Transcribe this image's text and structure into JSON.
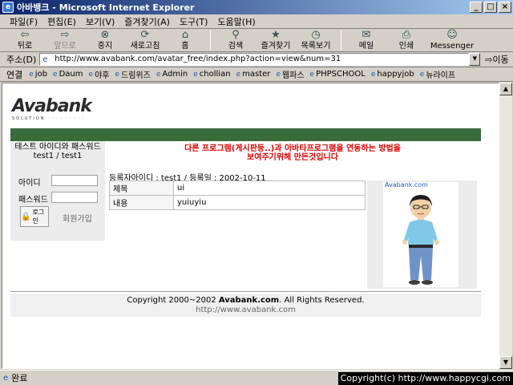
{
  "window": {
    "title": "아바뱅크 - Microsoft Internet Explorer"
  },
  "menu": [
    "파일(F)",
    "편집(E)",
    "보기(V)",
    "즐겨찾기(A)",
    "도구(T)",
    "도움말(H)"
  ],
  "toolbar": {
    "back": "뒤로",
    "forward": "앞으로",
    "stop": "중지",
    "refresh": "새로고침",
    "home": "홈",
    "search": "검색",
    "favorites": "즐겨찾기",
    "history": "목록보기",
    "mail": "메일",
    "print": "인쇄",
    "messenger": "Messenger"
  },
  "address": {
    "label": "주소(D)",
    "url": "http://www.avabank.com/avatar_free/index.php?action=view&num=31",
    "go": "이동"
  },
  "links": {
    "label": "연결",
    "items": [
      "job",
      "Daum",
      "야후",
      "드림위즈",
      "Admin",
      "chollian",
      "master",
      "웹파스",
      "PHPSCHOOL",
      "happyjob",
      "뉴라이프"
    ]
  },
  "page": {
    "logo_main": "Avabank",
    "logo_sub": "SOLUTION",
    "login": {
      "title_line1": "테스트 아이디와 패스워드",
      "title_line2": "test1 / test1",
      "id_label": "아이디",
      "pw_label": "패스워드",
      "login_button": "로그인",
      "signup": "회원가입"
    },
    "notice_line1": "다른 프로그램(게시판등..)과 아바타프로그램을 연동하는 방법을",
    "notice_line2": "보여주기위해 만든것입니다",
    "reg_info": "등록자아이디 : test1 / 등록일 : 2002-10-11",
    "rows": [
      {
        "label": "제목",
        "value": "ui"
      },
      {
        "label": "내용",
        "value": "yuiuyiu"
      }
    ],
    "avatar_caption": "Avabank.com",
    "footer_line1_pre": "Copyright 2000~2002 ",
    "footer_line1_brand": "Avabank.com",
    "footer_line1_post": ". All Rights Reserved.",
    "footer_line2": "http://www.avabank.com"
  },
  "status": {
    "text": "완료"
  },
  "credit": "Copyright(c) http://www.happycgi.com"
}
